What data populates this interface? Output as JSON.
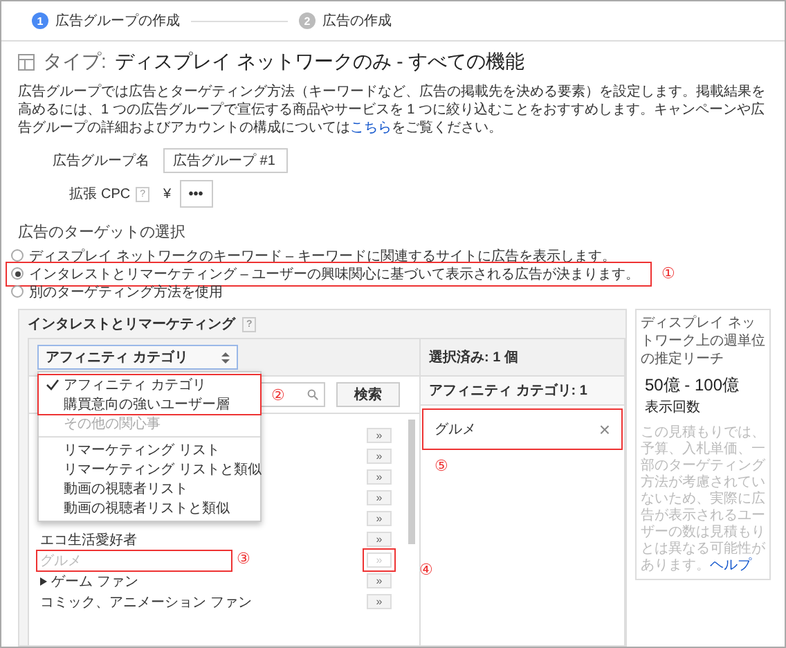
{
  "steps": [
    {
      "number": "1",
      "label": "広告グループの作成",
      "selected": true
    },
    {
      "number": "2",
      "label": "広告の作成",
      "selected": false
    }
  ],
  "title": {
    "prefix": "タイプ:",
    "text": "ディスプレイ ネットワークのみ - すべての機能"
  },
  "description": {
    "text": "広告グループでは広告とターゲティング方法（キーワードなど、広告の掲載先を決める要素）を設定します。掲載結果を高めるには、1 つの広告グループで宣伝する商品やサービスを 1 つに絞り込むことをおすすめします。キャンペーンや広告グループの詳細およびアカウントの構成については",
    "link": "こちら",
    "suffix": "をご覧ください。"
  },
  "fields": [
    {
      "kind": "text",
      "label": "広告グループ名",
      "value": "広告グループ #1"
    },
    {
      "kind": "currency",
      "label": "拡張 CPC",
      "help": "?",
      "currency": "¥",
      "value": "•••"
    }
  ],
  "targeting": {
    "heading": "広告のターゲットの選択",
    "options": [
      {
        "label": "ディスプレイ ネットワークのキーワード – キーワードに関連するサイトに広告を表示します。",
        "selected": false
      },
      {
        "label": "インタレストとリマーケティング – ユーザーの興味関心に基づいて表示される広告が決まります。",
        "selected": true,
        "annotation": "①"
      },
      {
        "label": "別のターゲティング方法を使用",
        "selected": false
      }
    ]
  },
  "panel": {
    "title": "インタレストとリマーケティング",
    "help": "?",
    "dropdown": {
      "value": "アフィニティ カテゴリ"
    },
    "search_button": "検索",
    "menu": [
      {
        "kind": "options",
        "annotation": "②",
        "items": [
          {
            "label": "アフィニティ カテゴリ",
            "checked": true,
            "disabled": false
          },
          {
            "label": "購買意向の強いユーザー層",
            "checked": false,
            "disabled": false
          }
        ]
      },
      {
        "kind": "options",
        "items": [
          {
            "label": "その他の関心事",
            "checked": false,
            "disabled": true
          }
        ]
      },
      {
        "kind": "divider"
      },
      {
        "kind": "options",
        "items": [
          {
            "label": "リマーケティング リスト",
            "checked": false,
            "disabled": false
          },
          {
            "label": "リマーケティング リストと類似",
            "checked": false,
            "disabled": false
          },
          {
            "label": "動画の視聴者リスト",
            "checked": false,
            "disabled": false
          },
          {
            "label": "動画の視聴者リストと類似",
            "checked": false,
            "disabled": false
          }
        ]
      }
    ],
    "list": [
      {
        "button": "»",
        "disabled": false
      },
      {
        "button": "»",
        "disabled": false
      },
      {
        "button": "»",
        "disabled": false
      },
      {
        "button": "»",
        "disabled": false
      },
      {
        "button": "»",
        "disabled": false
      },
      {
        "label": "エコ生活愛好者",
        "button": "»",
        "disabled": false,
        "expandable": false
      },
      {
        "label": "グルメ",
        "button": "»",
        "disabled": true,
        "expandable": false,
        "annotation": "③",
        "button_annotation": "④"
      },
      {
        "label": "ゲーム ファン",
        "button": "»",
        "disabled": false,
        "expandable": true
      },
      {
        "label": "コミック、アニメーション ファン",
        "button": "»",
        "disabled": false,
        "expandable": false
      }
    ],
    "selected": {
      "heading": "選択済み: 1 個",
      "category": "アフィニティ カテゴリ: 1",
      "items": [
        {
          "label": "グルメ",
          "remove": "×",
          "annotation": "⑤"
        }
      ]
    }
  },
  "reach": {
    "title": "ディスプレイ ネットワーク上の週単位の推定リーチ",
    "value": "50億 - 100億",
    "unit": "表示回数",
    "note": "この見積もりでは、予算、入札単価、一部のターゲティング方法が考慮されていないため、実際に広告が表示されるユーザーの数は見積もりとは異なる可能性があります。",
    "link": "ヘルプ"
  }
}
